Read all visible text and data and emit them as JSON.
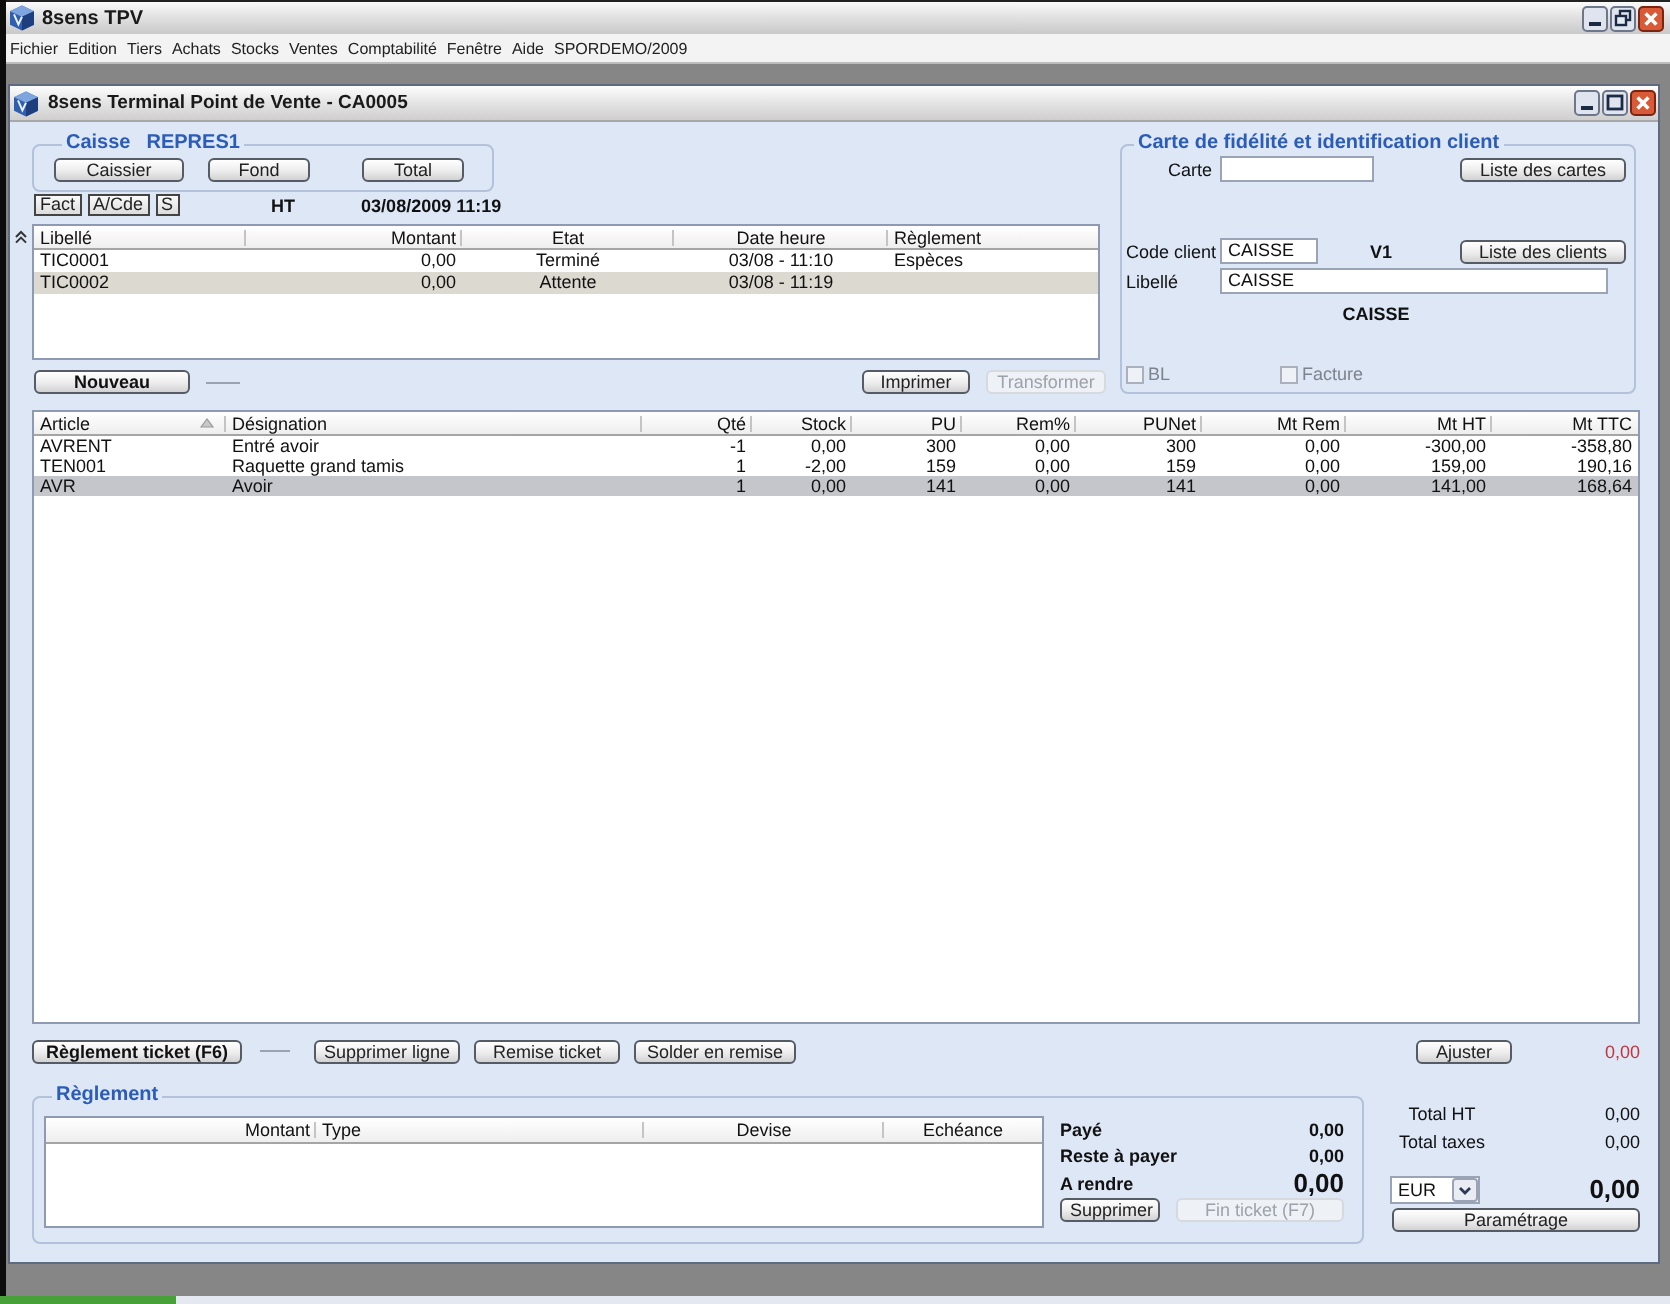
{
  "app_window": {
    "title": "8sens TPV"
  },
  "menu": [
    "Fichier",
    "Edition",
    "Tiers",
    "Achats",
    "Stocks",
    "Ventes",
    "Comptabilité",
    "Fenêtre",
    "Aide",
    "SPORDEMO/2009"
  ],
  "window": {
    "title": "8sens Terminal Point de Vente - CA0005"
  },
  "caisse": {
    "label": "Caisse",
    "register": "REPRES1",
    "buttons": [
      "Caissier",
      "Fond",
      "Total"
    ]
  },
  "modes": [
    "Fact",
    "A/Cde",
    "S"
  ],
  "price_basis": "HT",
  "datetime": "03/08/2009 11:19",
  "tickets": {
    "columns": [
      "Libellé",
      "Montant",
      "Etat",
      "Date heure",
      "Règlement"
    ],
    "rows": [
      {
        "cells": [
          "TIC0001",
          "0,00",
          "Terminé",
          "03/08 - 11:10",
          "Espèces"
        ],
        "selected": false
      },
      {
        "cells": [
          "TIC0002",
          "0,00",
          "Attente",
          "03/08 - 11:19"
        ],
        "selected": true
      }
    ]
  },
  "ticket_actions": {
    "new_button": "Nouveau",
    "buttons": [
      {
        "label": "Imprimer",
        "disabled": false
      },
      {
        "label": "Transformer",
        "disabled": true
      }
    ]
  },
  "client": {
    "title": "Carte de fidélité et identification client",
    "card_label": "Carte",
    "cards_button": "Liste des cartes",
    "code_label": "Code client",
    "code_value": "CAISSE",
    "tariff": "V1",
    "clients_button": "Liste des clients",
    "name_label": "Libellé",
    "name_value": "CAISSE",
    "name_display": "CAISSE",
    "checkboxes": [
      {
        "label": "BL",
        "checked": false,
        "disabled": true
      },
      {
        "label": "Facture",
        "checked": false,
        "disabled": true
      }
    ]
  },
  "articles": {
    "columns": [
      {
        "label": "Article",
        "sorted": true
      },
      {
        "label": "Désignation",
        "sorted": false
      },
      {
        "label": "Qté",
        "sorted": false
      },
      {
        "label": "Stock",
        "sorted": false
      },
      {
        "label": "PU",
        "sorted": false
      },
      {
        "label": "Rem%",
        "sorted": false
      },
      {
        "label": "PUNet",
        "sorted": false
      },
      {
        "label": "Mt Rem",
        "sorted": false
      },
      {
        "label": "Mt HT",
        "sorted": false
      },
      {
        "label": "Mt TTC",
        "sorted": false
      }
    ],
    "rows": [
      {
        "cells": [
          "AVRENT",
          "Entré avoir",
          "-1",
          "0,00",
          "300",
          "0,00",
          "300",
          "0,00",
          "-300,00",
          "-358,80"
        ],
        "selected": false
      },
      {
        "cells": [
          "TEN001",
          "Raquette grand tamis",
          "1",
          "-2,00",
          "159",
          "0,00",
          "159",
          "0,00",
          "159,00",
          "190,16"
        ],
        "selected": false
      },
      {
        "cells": [
          "AVR",
          "Avoir",
          "1",
          "0,00",
          "141",
          "0,00",
          "141",
          "0,00",
          "141,00",
          "168,64"
        ],
        "selected": true
      }
    ]
  },
  "line_actions": {
    "primary_button": "Règlement ticket (F6)",
    "buttons": [
      "Supprimer ligne",
      "Remise ticket",
      "Solder en remise"
    ],
    "adjust_button": "Ajuster",
    "adjust_value": "0,00"
  },
  "payment": {
    "title": "Règlement",
    "columns": [
      "Montant",
      "Type",
      "Devise",
      "Echéance"
    ],
    "summary": [
      {
        "label": "Payé",
        "value": "0,00",
        "kind": "normal"
      },
      {
        "label": "Reste à payer",
        "value": "0,00",
        "kind": "normal"
      },
      {
        "label": "A rendre",
        "value": "0,00",
        "kind": "large"
      }
    ],
    "buttons": [
      {
        "label": "Supprimer",
        "disabled": false
      },
      {
        "label": "Fin ticket (F7)",
        "disabled": true
      }
    ]
  },
  "totals": {
    "rows": [
      {
        "label": "Total HT",
        "value": "0,00"
      },
      {
        "label": "Total taxes",
        "value": "0,00"
      }
    ],
    "currency": "EUR",
    "grand_total": "0,00",
    "settings_button": "Paramétrage"
  }
}
